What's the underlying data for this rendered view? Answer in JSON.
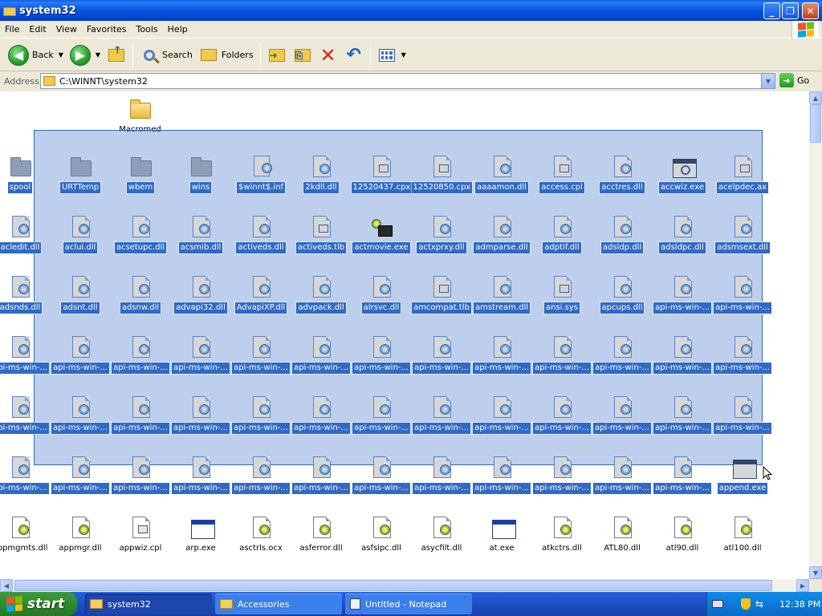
{
  "window": {
    "title": "system32"
  },
  "menu": [
    "File",
    "Edit",
    "View",
    "Favorites",
    "Tools",
    "Help"
  ],
  "toolbar": {
    "back": "Back",
    "search": "Search",
    "folders": "Folders"
  },
  "address": {
    "label": "Address",
    "value": "C:\\WINNT\\system32",
    "go": "Go"
  },
  "folder_top": {
    "label": "Macromed"
  },
  "rows": [
    [
      {
        "l": "spool",
        "t": "gfolder",
        "s": 1
      },
      {
        "l": "URTTemp",
        "t": "gfolder",
        "s": 1
      },
      {
        "l": "wbem",
        "t": "gfolder",
        "s": 1
      },
      {
        "l": "wins",
        "t": "gfolder",
        "s": 1
      },
      {
        "l": "$winnt$.inf",
        "t": "inf",
        "s": 1
      },
      {
        "l": "2kdll.dll",
        "t": "dll",
        "s": 1
      },
      {
        "l": "12520437.cpx",
        "t": "sys",
        "s": 1
      },
      {
        "l": "12520850.cpx",
        "t": "sys",
        "s": 1
      },
      {
        "l": "aaaamon.dll",
        "t": "dll",
        "s": 1
      },
      {
        "l": "access.cpl",
        "t": "sys",
        "s": 1
      },
      {
        "l": "acctres.dll",
        "t": "dll",
        "s": 1
      },
      {
        "l": "accwiz.exe",
        "t": "wiz",
        "s": 1
      },
      {
        "l": "acelpdec.ax",
        "t": "sys",
        "s": 1
      }
    ],
    [
      {
        "l": "acledit.dll",
        "t": "dll",
        "s": 1
      },
      {
        "l": "aclui.dll",
        "t": "dll",
        "s": 1
      },
      {
        "l": "acsetupc.dll",
        "t": "dll",
        "s": 1
      },
      {
        "l": "acsmib.dll",
        "t": "dll",
        "s": 1
      },
      {
        "l": "activeds.dll",
        "t": "dll",
        "s": 1
      },
      {
        "l": "activeds.tlb",
        "t": "sys",
        "s": 1
      },
      {
        "l": "actmovie.exe",
        "t": "movie",
        "s": 1
      },
      {
        "l": "actxprxy.dll",
        "t": "dll",
        "s": 1
      },
      {
        "l": "admparse.dll",
        "t": "dll",
        "s": 1
      },
      {
        "l": "adptif.dll",
        "t": "dll",
        "s": 1
      },
      {
        "l": "adsldp.dll",
        "t": "dll",
        "s": 1
      },
      {
        "l": "adsldpc.dll",
        "t": "dll",
        "s": 1
      },
      {
        "l": "adsmsext.dll",
        "t": "dll",
        "s": 1
      }
    ],
    [
      {
        "l": "adsnds.dll",
        "t": "dll",
        "s": 1
      },
      {
        "l": "adsnt.dll",
        "t": "dll",
        "s": 1
      },
      {
        "l": "adsnw.dll",
        "t": "dll",
        "s": 1
      },
      {
        "l": "advapi32.dll",
        "t": "dll",
        "s": 1
      },
      {
        "l": "AdvapiXP.dll",
        "t": "dll",
        "s": 1
      },
      {
        "l": "advpack.dll",
        "t": "dll",
        "s": 1
      },
      {
        "l": "alrsvc.dll",
        "t": "dll",
        "s": 1
      },
      {
        "l": "amcompat.tlb",
        "t": "sys",
        "s": 1
      },
      {
        "l": "amstream.dll",
        "t": "dll",
        "s": 1
      },
      {
        "l": "ansi.sys",
        "t": "sys",
        "s": 1
      },
      {
        "l": "apcups.dll",
        "t": "dll",
        "s": 1
      },
      {
        "l": "api-ms-win-...",
        "t": "dll",
        "s": 1
      },
      {
        "l": "api-ms-win-...",
        "t": "dll",
        "s": 1
      }
    ],
    [
      {
        "l": "api-ms-win-...",
        "t": "dll",
        "s": 1
      },
      {
        "l": "api-ms-win-...",
        "t": "dll",
        "s": 1
      },
      {
        "l": "api-ms-win-...",
        "t": "dll",
        "s": 1
      },
      {
        "l": "api-ms-win-...",
        "t": "dll",
        "s": 1
      },
      {
        "l": "api-ms-win-...",
        "t": "dll",
        "s": 1
      },
      {
        "l": "api-ms-win-...",
        "t": "dll",
        "s": 1
      },
      {
        "l": "api-ms-win-...",
        "t": "dll",
        "s": 1
      },
      {
        "l": "api-ms-win-...",
        "t": "dll",
        "s": 1
      },
      {
        "l": "api-ms-win-...",
        "t": "dll",
        "s": 1
      },
      {
        "l": "api-ms-win-...",
        "t": "dll",
        "s": 1
      },
      {
        "l": "api-ms-win-...",
        "t": "dll",
        "s": 1
      },
      {
        "l": "api-ms-win-...",
        "t": "dll",
        "s": 1
      },
      {
        "l": "api-ms-win-...",
        "t": "dll",
        "s": 1
      }
    ],
    [
      {
        "l": "api-ms-win-...",
        "t": "dll",
        "s": 1
      },
      {
        "l": "api-ms-win-...",
        "t": "dll",
        "s": 1
      },
      {
        "l": "api-ms-win-...",
        "t": "dll",
        "s": 1
      },
      {
        "l": "api-ms-win-...",
        "t": "dll",
        "s": 1
      },
      {
        "l": "api-ms-win-...",
        "t": "dll",
        "s": 1
      },
      {
        "l": "api-ms-win-...",
        "t": "dll",
        "s": 1
      },
      {
        "l": "api-ms-win-...",
        "t": "dll",
        "s": 1
      },
      {
        "l": "api-ms-win-...",
        "t": "dll",
        "s": 1
      },
      {
        "l": "api-ms-win-...",
        "t": "dll",
        "s": 1
      },
      {
        "l": "api-ms-win-...",
        "t": "dll",
        "s": 1
      },
      {
        "l": "api-ms-win-...",
        "t": "dll",
        "s": 1
      },
      {
        "l": "api-ms-win-...",
        "t": "dll",
        "s": 1
      },
      {
        "l": "api-ms-win-...",
        "t": "dll",
        "s": 1
      }
    ],
    [
      {
        "l": "api-ms-win-...",
        "t": "dll",
        "s": 1
      },
      {
        "l": "api-ms-win-...",
        "t": "dll",
        "s": 1
      },
      {
        "l": "api-ms-win-...",
        "t": "dll",
        "s": 1
      },
      {
        "l": "api-ms-win-...",
        "t": "dll",
        "s": 1
      },
      {
        "l": "api-ms-win-...",
        "t": "dll",
        "s": 1
      },
      {
        "l": "api-ms-win-...",
        "t": "dll",
        "s": 1
      },
      {
        "l": "api-ms-win-...",
        "t": "dll",
        "s": 1
      },
      {
        "l": "api-ms-win-...",
        "t": "dll",
        "s": 1
      },
      {
        "l": "api-ms-win-...",
        "t": "dll",
        "s": 1
      },
      {
        "l": "api-ms-win-...",
        "t": "dll",
        "s": 1
      },
      {
        "l": "api-ms-win-...",
        "t": "dll",
        "s": 1
      },
      {
        "l": "api-ms-win-...",
        "t": "dll",
        "s": 1
      },
      {
        "l": "append.exe",
        "t": "exe",
        "s": 1
      }
    ],
    [
      {
        "l": "appmgmts.dll",
        "t": "dll",
        "s": 0
      },
      {
        "l": "appmgr.dll",
        "t": "dll",
        "s": 0
      },
      {
        "l": "appwiz.cpl",
        "t": "sys",
        "s": 0
      },
      {
        "l": "arp.exe",
        "t": "exe",
        "s": 0
      },
      {
        "l": "asctrls.ocx",
        "t": "dll",
        "s": 0
      },
      {
        "l": "asferror.dll",
        "t": "dll",
        "s": 0
      },
      {
        "l": "asfsipc.dll",
        "t": "dll",
        "s": 0
      },
      {
        "l": "asycfilt.dll",
        "t": "dll",
        "s": 0
      },
      {
        "l": "at.exe",
        "t": "exe",
        "s": 0
      },
      {
        "l": "atkctrs.dll",
        "t": "dll",
        "s": 0
      },
      {
        "l": "ATL80.dll",
        "t": "dll",
        "s": 0
      },
      {
        "l": "atl90.dll",
        "t": "dll",
        "s": 0
      },
      {
        "l": "atl100.dll",
        "t": "dll",
        "s": 0
      }
    ]
  ],
  "taskbar": {
    "start": "start",
    "tasks": [
      {
        "label": "system32",
        "active": true
      },
      {
        "label": "Accessories",
        "active": false
      },
      {
        "label": "Untitled - Notepad",
        "active": false
      }
    ],
    "clock": "12:38 PM"
  }
}
